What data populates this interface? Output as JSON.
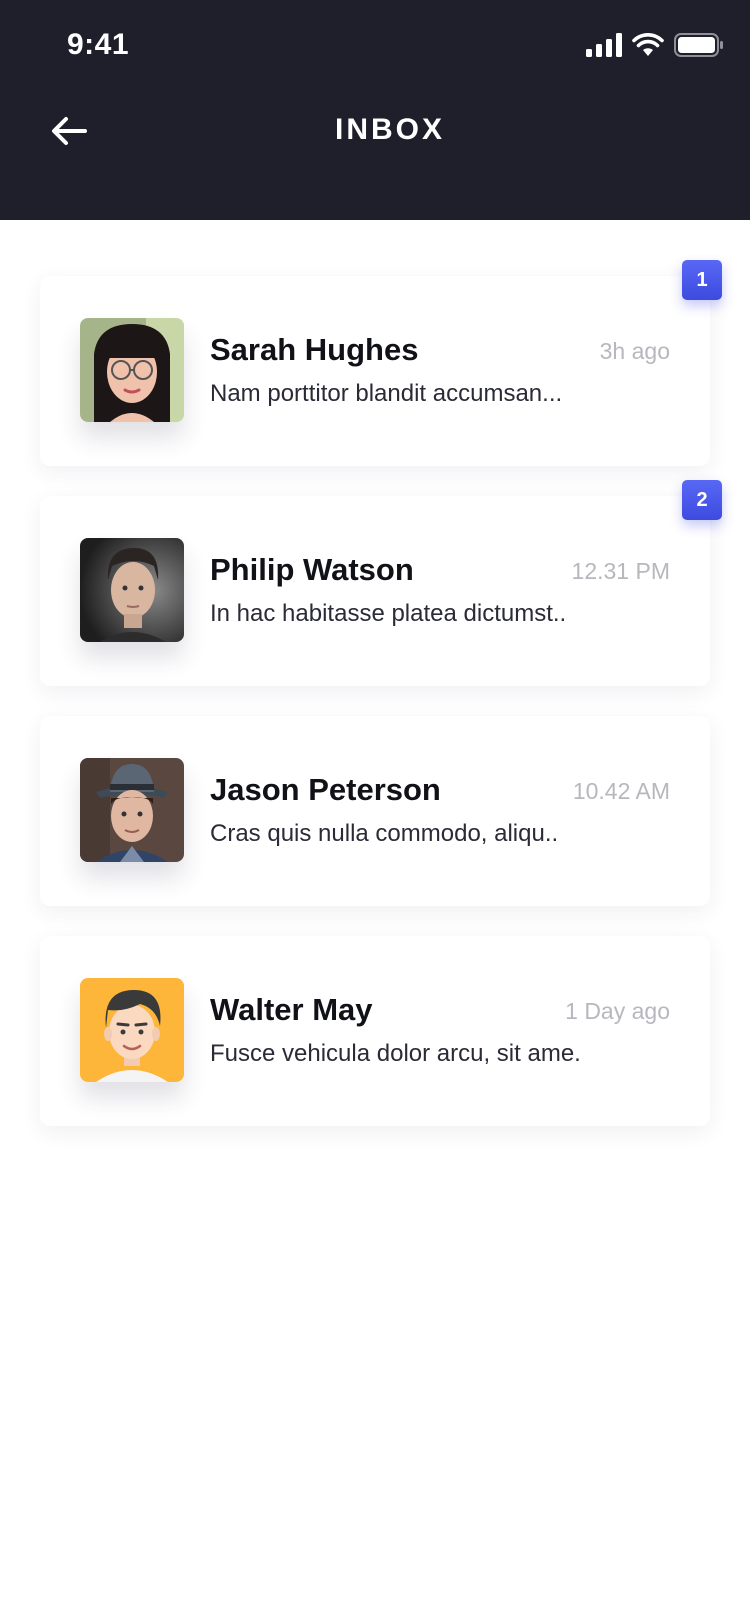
{
  "status_bar": {
    "time": "9:41",
    "icons": [
      "cellular-signal-icon",
      "wifi-icon",
      "battery-icon"
    ]
  },
  "header": {
    "back_icon": "arrow-left-icon",
    "title": "INBOX"
  },
  "colors": {
    "header_bg": "#1f1f2b",
    "badge": "#4a58eb",
    "timestamp": "#b7b7bd"
  },
  "messages": [
    {
      "name": "Sarah Hughes",
      "time": "3h ago",
      "preview": "Nam porttitor blandit accumsan...",
      "badge": "1"
    },
    {
      "name": "Philip Watson",
      "time": "12.31 PM",
      "preview": "In hac habitasse platea dictumst..",
      "badge": "2"
    },
    {
      "name": "Jason Peterson",
      "time": "10.42 AM",
      "preview": "Cras quis nulla commodo, aliqu..",
      "badge": null
    },
    {
      "name": "Walter May",
      "time": "1 Day ago",
      "preview": "Fusce vehicula dolor arcu, sit ame.",
      "badge": null
    }
  ]
}
